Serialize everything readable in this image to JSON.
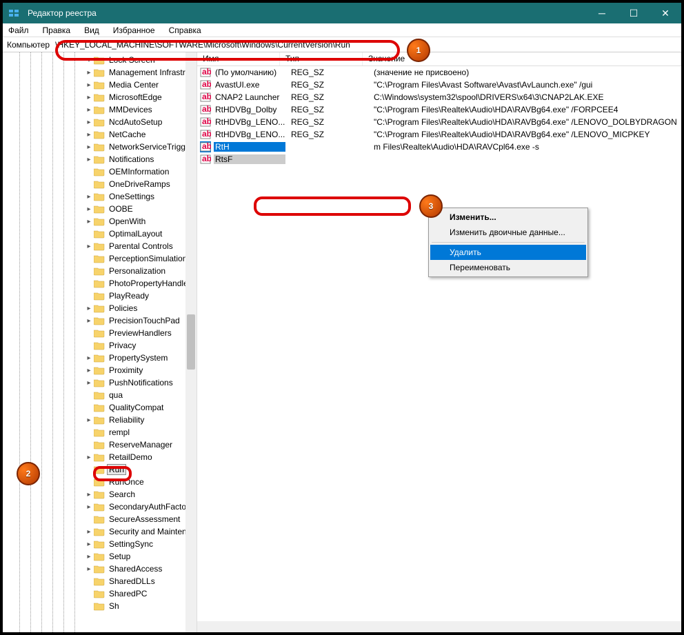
{
  "window": {
    "title": "Редактор реестра"
  },
  "menu": {
    "file": "Файл",
    "edit": "Правка",
    "view": "Вид",
    "fav": "Избранное",
    "help": "Справка"
  },
  "address": {
    "label": "Компьютер",
    "path": "\\HKEY_LOCAL_MACHINE\\SOFTWARE\\Microsoft\\Windows\\CurrentVersion\\Run"
  },
  "tree": [
    {
      "n": "Lock Screen",
      "e": "v"
    },
    {
      "n": "Management Infrastru",
      "e": ">"
    },
    {
      "n": "Media Center",
      "e": ">"
    },
    {
      "n": "MicrosoftEdge",
      "e": ">"
    },
    {
      "n": "MMDevices",
      "e": ">"
    },
    {
      "n": "NcdAutoSetup",
      "e": ">"
    },
    {
      "n": "NetCache",
      "e": ">"
    },
    {
      "n": "NetworkServiceTrigge",
      "e": ">"
    },
    {
      "n": "Notifications",
      "e": ">"
    },
    {
      "n": "OEMInformation",
      "e": ""
    },
    {
      "n": "OneDriveRamps",
      "e": ""
    },
    {
      "n": "OneSettings",
      "e": ">"
    },
    {
      "n": "OOBE",
      "e": ">"
    },
    {
      "n": "OpenWith",
      "e": ">"
    },
    {
      "n": "OptimalLayout",
      "e": ""
    },
    {
      "n": "Parental Controls",
      "e": ">"
    },
    {
      "n": "PerceptionSimulation",
      "e": ""
    },
    {
      "n": "Personalization",
      "e": ""
    },
    {
      "n": "PhotoPropertyHandle",
      "e": ""
    },
    {
      "n": "PlayReady",
      "e": ""
    },
    {
      "n": "Policies",
      "e": ">"
    },
    {
      "n": "PrecisionTouchPad",
      "e": ">"
    },
    {
      "n": "PreviewHandlers",
      "e": ""
    },
    {
      "n": "Privacy",
      "e": ""
    },
    {
      "n": "PropertySystem",
      "e": ">"
    },
    {
      "n": "Proximity",
      "e": ">"
    },
    {
      "n": "PushNotifications",
      "e": ">"
    },
    {
      "n": "qua",
      "e": ""
    },
    {
      "n": "QualityCompat",
      "e": ""
    },
    {
      "n": "Reliability",
      "e": ">"
    },
    {
      "n": "rempl",
      "e": ""
    },
    {
      "n": "ReserveManager",
      "e": ""
    },
    {
      "n": "RetailDemo",
      "e": ">"
    },
    {
      "n": "Run",
      "e": "",
      "sel": true
    },
    {
      "n": "RunOnce",
      "e": ""
    },
    {
      "n": "Search",
      "e": ">"
    },
    {
      "n": "SecondaryAuthFactor",
      "e": ">"
    },
    {
      "n": "SecureAssessment",
      "e": ""
    },
    {
      "n": "Security and Maintena",
      "e": ">"
    },
    {
      "n": "SettingSync",
      "e": ">"
    },
    {
      "n": "Setup",
      "e": ">"
    },
    {
      "n": "SharedAccess",
      "e": ">"
    },
    {
      "n": "SharedDLLs",
      "e": ""
    },
    {
      "n": "SharedPC",
      "e": ""
    },
    {
      "n": "Sh",
      "e": ""
    }
  ],
  "cols": {
    "name": "Имя",
    "type": "Тип",
    "value": "Значение"
  },
  "values": [
    {
      "name": "(По умолчанию)",
      "type": "REG_SZ",
      "val": "(значение не присвоено)"
    },
    {
      "name": "AvastUI.exe",
      "type": "REG_SZ",
      "val": "\"C:\\Program Files\\Avast Software\\Avast\\AvLaunch.exe\" /gui"
    },
    {
      "name": "CNAP2 Launcher",
      "type": "REG_SZ",
      "val": "C:\\Windows\\system32\\spool\\DRIVERS\\x64\\3\\CNAP2LAK.EXE"
    },
    {
      "name": "RtHDVBg_Dolby",
      "type": "REG_SZ",
      "val": "\"C:\\Program Files\\Realtek\\Audio\\HDA\\RAVBg64.exe\" /FORPCEE4"
    },
    {
      "name": "RtHDVBg_LENO...",
      "type": "REG_SZ",
      "val": "\"C:\\Program Files\\Realtek\\Audio\\HDA\\RAVBg64.exe\" /LENOVO_DOLBYDRAGON"
    },
    {
      "name": "RtHDVBg_LENO...",
      "type": "REG_SZ",
      "val": "\"C:\\Program Files\\Realtek\\Audio\\HDA\\RAVBg64.exe\" /LENOVO_MICPKEY"
    },
    {
      "name": "RtH",
      "type": "",
      "val": "m Files\\Realtek\\Audio\\HDA\\RAVCpl64.exe -s",
      "sel": true
    },
    {
      "name": "RtsF",
      "type": "",
      "val": "",
      "dim": true
    }
  ],
  "ctx": {
    "modify": "Изменить...",
    "modbin": "Изменить двоичные данные...",
    "delete": "Удалить",
    "rename": "Переименовать"
  },
  "badges": {
    "b1": "1",
    "b2": "2",
    "b3": "3"
  }
}
